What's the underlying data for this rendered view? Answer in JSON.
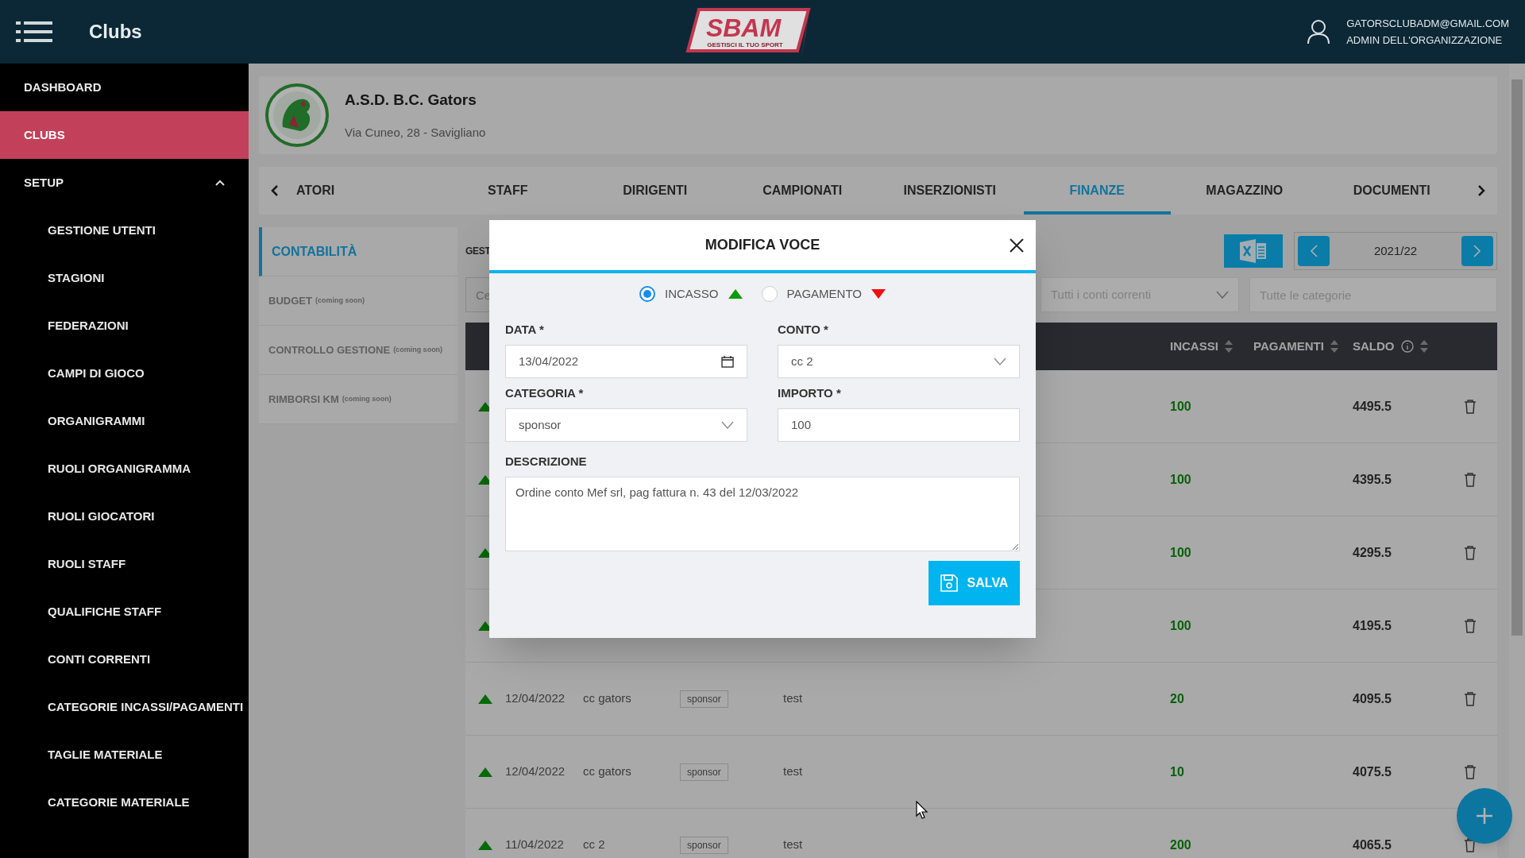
{
  "header": {
    "title": "Clubs",
    "logo": {
      "name": "SBAM",
      "tagline": "GESTISCI IL TUO SPORT"
    },
    "user": {
      "email": "GATORSCLUBADM@GMAIL.COM",
      "role": "ADMIN DELL'ORGANIZZAZIONE"
    }
  },
  "sidebar": {
    "items": [
      {
        "label": "DASHBOARD",
        "selected": false
      },
      {
        "label": "CLUBS",
        "selected": true
      },
      {
        "label": "SETUP",
        "selected": false,
        "expanded": true,
        "children": [
          {
            "label": "GESTIONE UTENTI"
          },
          {
            "label": "STAGIONI"
          },
          {
            "label": "FEDERAZIONI"
          },
          {
            "label": "CAMPI DI GIOCO"
          },
          {
            "label": "ORGANIGRAMMI"
          },
          {
            "label": "RUOLI ORGANIGRAMMA"
          },
          {
            "label": "RUOLI GIOCATORI"
          },
          {
            "label": "RUOLI STAFF"
          },
          {
            "label": "QUALIFICHE STAFF"
          },
          {
            "label": "CONTI CORRENTI"
          },
          {
            "label": "CATEGORIE INCASSI/PAGAMENTI"
          },
          {
            "label": "TAGLIE MATERIALE"
          },
          {
            "label": "CATEGORIE MATERIALE"
          }
        ]
      }
    ]
  },
  "club": {
    "name": "A.S.D. B.C. Gators",
    "address": "Via Cuneo, 28 - Savigliano"
  },
  "tabs": [
    {
      "label": "ATORI",
      "selected": false
    },
    {
      "label": "STAFF",
      "selected": false
    },
    {
      "label": "DIRIGENTI",
      "selected": false
    },
    {
      "label": "CAMPIONATI",
      "selected": false
    },
    {
      "label": "INSERZIONISTI",
      "selected": false
    },
    {
      "label": "FINANZE",
      "selected": true
    },
    {
      "label": "MAGAZZINO",
      "selected": false
    },
    {
      "label": "DOCUMENTI",
      "selected": false
    }
  ],
  "finance_nav": [
    {
      "label": "CONTABILITÀ",
      "selected": true,
      "disabled": false
    },
    {
      "label": "BUDGET",
      "note": "(coming soon)",
      "selected": false,
      "disabled": true
    },
    {
      "label": "CONTROLLO GESTIONE",
      "note": "(coming soon)",
      "selected": false,
      "disabled": true
    },
    {
      "label": "RIMBORSI KM",
      "note": "(coming soon)",
      "selected": false,
      "disabled": true
    }
  ],
  "section_title": "GEST",
  "season": "2021/22",
  "filters": {
    "search_placeholder": "Ce",
    "account_placeholder": "Tutti i conti correnti",
    "category_placeholder": "Tutte le categorie"
  },
  "table": {
    "columns": [
      "INCASSI",
      "PAGAMENTI",
      "SALDO"
    ],
    "rows": [
      {
        "kind": "incasso",
        "incassi": "100",
        "saldo": "4495.5"
      },
      {
        "kind": "incasso",
        "incassi": "100",
        "saldo": "4395.5"
      },
      {
        "kind": "incasso",
        "incassi": "100",
        "saldo": "4295.5"
      },
      {
        "kind": "incasso",
        "incassi": "100",
        "saldo": "4195.5"
      },
      {
        "kind": "incasso",
        "date": "12/04/2022",
        "account": "cc gators",
        "category": "sponsor",
        "description": "test",
        "incassi": "20",
        "saldo": "4095.5"
      },
      {
        "kind": "incasso",
        "date": "12/04/2022",
        "account": "cc gators",
        "category": "sponsor",
        "description": "test",
        "incassi": "10",
        "saldo": "4075.5"
      },
      {
        "kind": "incasso",
        "date": "11/04/2022",
        "account": "cc 2",
        "category": "sponsor",
        "description": "test",
        "incassi": "200",
        "saldo": "4065.5"
      }
    ]
  },
  "modal": {
    "title": "MODIFICA VOCE",
    "type_options": [
      {
        "label": "INCASSO",
        "kind": "incasso",
        "selected": true
      },
      {
        "label": "PAGAMENTO",
        "kind": "pagamento",
        "selected": false
      }
    ],
    "date": {
      "label": "DATA *",
      "value": "13/04/2022"
    },
    "account": {
      "label": "CONTO *",
      "value": "cc 2"
    },
    "category": {
      "label": "CATEGORIA *",
      "value": "sponsor"
    },
    "amount": {
      "label": "IMPORTO *",
      "value": "100"
    },
    "description": {
      "label": "DESCRIZIONE",
      "value": "Ordine conto Mef srl, pag fattura n. 43 del 12/03/2022"
    },
    "save": "SALVA"
  }
}
